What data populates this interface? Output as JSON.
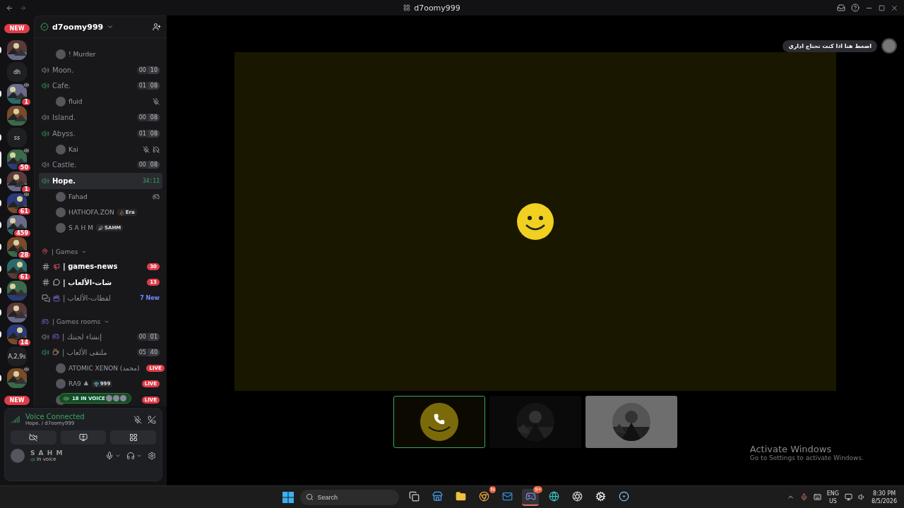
{
  "titlebar": {
    "title": "d7oomy999"
  },
  "servers": [
    {
      "kind": "new",
      "label": "NEW"
    },
    {
      "kind": "picture",
      "unread": true,
      "selected": false,
      "voice": false
    },
    {
      "kind": "text",
      "label": "dh",
      "unread": false,
      "selected": false,
      "voice": false
    },
    {
      "kind": "picture",
      "unread": true,
      "selected": false,
      "voice": true,
      "badge": "1"
    },
    {
      "kind": "picture",
      "unread": false,
      "selected": false,
      "voice": false
    },
    {
      "kind": "text",
      "label": "ss",
      "unread": true,
      "selected": false,
      "voice": false
    },
    {
      "kind": "picture",
      "unread": false,
      "selected": true,
      "voice": true,
      "badge": "50"
    },
    {
      "kind": "picture",
      "unread": true,
      "selected": false,
      "voice": false,
      "badge": "1"
    },
    {
      "kind": "picture",
      "unread": true,
      "selected": false,
      "voice": true,
      "badge": "61"
    },
    {
      "kind": "picture",
      "unread": true,
      "selected": false,
      "voice": false,
      "badge": "459"
    },
    {
      "kind": "picture",
      "unread": true,
      "selected": false,
      "voice": false,
      "badge": "28"
    },
    {
      "kind": "picture",
      "unread": true,
      "selected": false,
      "voice": false,
      "badge": "61"
    },
    {
      "kind": "picture",
      "unread": true,
      "selected": false,
      "voice": false
    },
    {
      "kind": "picture",
      "unread": true,
      "selected": false,
      "voice": false
    },
    {
      "kind": "picture",
      "unread": true,
      "selected": false,
      "voice": false,
      "badge": "14"
    },
    {
      "kind": "text",
      "label": "A,2,9s",
      "unread": false,
      "selected": false,
      "voice": false
    },
    {
      "kind": "picture",
      "unread": true,
      "selected": false,
      "voice": true
    },
    {
      "kind": "new",
      "label": "NEW"
    }
  ],
  "channels": {
    "server_name": "d7oomy999",
    "items": [
      {
        "kind": "member",
        "name": "! Murder"
      },
      {
        "kind": "voice",
        "name": "Moon.",
        "active": false,
        "selected": false,
        "count": "00",
        "limit": "10"
      },
      {
        "kind": "voice",
        "name": "Cafe.",
        "active": true,
        "selected": false,
        "count": "01",
        "limit": "08"
      },
      {
        "kind": "member",
        "name": "fluid"
      },
      {
        "kind": "voice",
        "name": "Island.",
        "active": false,
        "selected": false,
        "count": "00",
        "limit": "08"
      },
      {
        "kind": "voice",
        "name": "Abyss.",
        "active": true,
        "selected": false,
        "count": "01",
        "limit": "08"
      },
      {
        "kind": "member",
        "name": "Kai"
      },
      {
        "kind": "voice",
        "name": "Castle.",
        "active": false,
        "selected": false,
        "count": "00",
        "limit": "08"
      },
      {
        "kind": "voice",
        "name": "Hope.",
        "active": true,
        "selected": true,
        "timer": "34:11"
      },
      {
        "kind": "member",
        "name": "Fahad"
      },
      {
        "kind": "member",
        "name": "HATHOFA.ZON",
        "tag": "Era"
      },
      {
        "kind": "member",
        "name": "S A H M",
        "tag": "SAHM"
      },
      {
        "kind": "category",
        "name": "| Games"
      },
      {
        "kind": "text",
        "name": "| games-news",
        "unread": true,
        "badge": "30"
      },
      {
        "kind": "text",
        "name": "| شات-الألعاب",
        "unread": true,
        "badge": "13"
      },
      {
        "kind": "forum",
        "name": "| لقطات-الألعاب",
        "unread": false,
        "new_label": "7 New"
      },
      {
        "kind": "category",
        "name": "| Games rooms"
      },
      {
        "kind": "voice",
        "name": "| إنشاء لجنتك",
        "active": false,
        "selected": false,
        "count": "00",
        "limit": "01"
      },
      {
        "kind": "voice",
        "name": "| ملتقى الألعاب",
        "active": true,
        "selected": false,
        "count": "05",
        "limit": "40"
      },
      {
        "kind": "member",
        "name": "ATOMIC XENON (محمد)",
        "live": "LIVE"
      },
      {
        "kind": "member",
        "name": "RA9 ♣",
        "tag": "999",
        "live": "LIVE"
      },
      {
        "kind": "member",
        "live": "LIVE"
      }
    ],
    "voice_pill": {
      "label": "18 IN VOICE"
    }
  },
  "voice_panel": {
    "status": "Voice Connected",
    "channel": "Hope. / d7oomy999"
  },
  "user": {
    "name": "S A H M",
    "status": "In voice"
  },
  "tooltip": {
    "text": "اضغط هنا اذا كنت تحتاج اداري"
  },
  "stage": {
    "tiles": [
      {
        "kind": "call",
        "selected": true
      },
      {
        "kind": "dark",
        "selected": false
      },
      {
        "kind": "light",
        "selected": false
      }
    ]
  },
  "watermark": {
    "title": "Activate Windows",
    "subtitle": "Go to Settings to activate Windows."
  },
  "taskbar": {
    "search": {
      "placeholder": "Search"
    },
    "apps": [
      {
        "kind": "taskview",
        "active": false
      },
      {
        "kind": "store",
        "active": false
      },
      {
        "kind": "folder",
        "active": false
      },
      {
        "kind": "chrome",
        "active": false,
        "badge": "N"
      },
      {
        "kind": "mail",
        "active": false
      },
      {
        "kind": "discord",
        "active": true,
        "badge": "9+"
      },
      {
        "kind": "edge",
        "active": false
      },
      {
        "kind": "obs",
        "active": false
      },
      {
        "kind": "gear",
        "active": false
      },
      {
        "kind": "steam",
        "active": false
      }
    ],
    "language": [
      "ENG",
      "US"
    ],
    "time": "8:30 PM",
    "date": "8/5/2026"
  }
}
